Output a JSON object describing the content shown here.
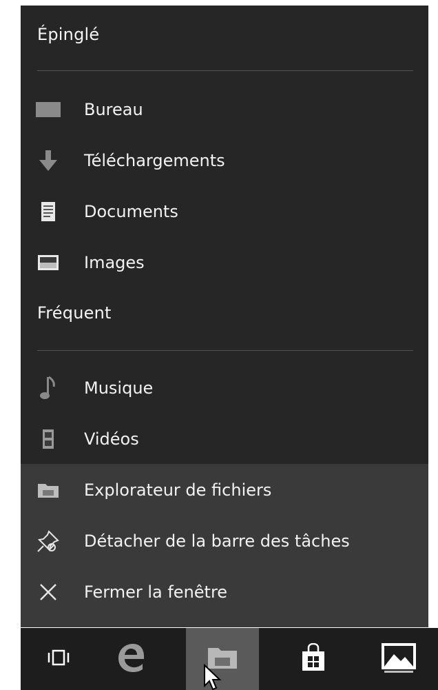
{
  "jumplist": {
    "pinned_heading": "Épinglé",
    "pinned_items": [
      {
        "label": "Bureau",
        "icon": "desktop-icon"
      },
      {
        "label": "Téléchargements",
        "icon": "download-arrow-icon"
      },
      {
        "label": "Documents",
        "icon": "document-icon"
      },
      {
        "label": "Images",
        "icon": "image-icon"
      }
    ],
    "frequent_heading": "Fréquent",
    "frequent_items": [
      {
        "label": "Musique",
        "icon": "music-note-icon"
      },
      {
        "label": "Vidéos",
        "icon": "film-icon"
      }
    ],
    "actions": [
      {
        "label": "Explorateur de fichiers",
        "icon": "folder-icon"
      },
      {
        "label": "Détacher de la barre des tâches",
        "icon": "unpin-icon"
      },
      {
        "label": "Fermer la fenêtre",
        "icon": "close-icon"
      }
    ]
  },
  "taskbar": {
    "buttons": [
      {
        "name": "task-view",
        "icon": "task-view-icon"
      },
      {
        "name": "edge",
        "icon": "edge-icon"
      },
      {
        "name": "file-explorer",
        "icon": "folder-icon",
        "active": true
      },
      {
        "name": "store",
        "icon": "store-bag-icon"
      },
      {
        "name": "photos",
        "icon": "photos-icon"
      }
    ]
  },
  "colors": {
    "menu_background": "#262626",
    "actions_background": "#3a3a3a",
    "taskbar_background": "#1d1d1d",
    "active_taskbar_button": "#5a5a5a",
    "text": "#f2f2f2"
  }
}
